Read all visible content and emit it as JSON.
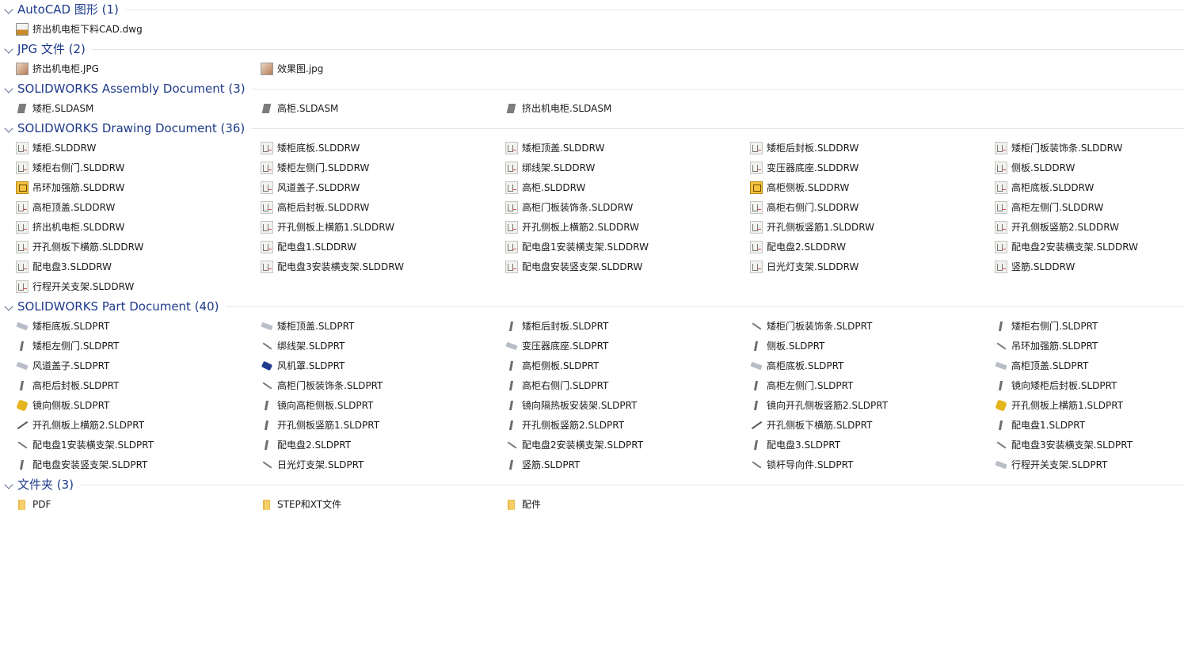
{
  "groups": [
    {
      "title": "AutoCAD 图形 (1)",
      "items": [
        {
          "label": "挤出机电柜下料CAD.dwg",
          "icon": "dwg-file-icon"
        }
      ]
    },
    {
      "title": "JPG 文件 (2)",
      "items": [
        {
          "label": "挤出机电柜.JPG",
          "icon": "jpg-file-icon"
        },
        {
          "label": "效果图.jpg",
          "icon": "jpg-file-icon"
        }
      ]
    },
    {
      "title": "SOLIDWORKS Assembly Document (3)",
      "items": [
        {
          "label": "矮柜.SLDASM",
          "icon": "assembly-icon"
        },
        {
          "label": "高柜.SLDASM",
          "icon": "assembly-icon"
        },
        {
          "label": "挤出机电柜.SLDASM",
          "icon": "assembly-icon"
        }
      ]
    },
    {
      "title": "SOLIDWORKS Drawing Document (36)",
      "items": [
        {
          "label": "矮柜.SLDDRW",
          "icon": "drawing-icon"
        },
        {
          "label": "矮柜底板.SLDDRW",
          "icon": "drawing-icon"
        },
        {
          "label": "矮柜顶盖.SLDDRW",
          "icon": "drawing-icon"
        },
        {
          "label": "矮柜后封板.SLDDRW",
          "icon": "drawing-icon"
        },
        {
          "label": "矮柜门板装饰条.SLDDRW",
          "icon": "drawing-icon"
        },
        {
          "label": "矮柜右侧门.SLDDRW",
          "icon": "drawing-icon"
        },
        {
          "label": "矮柜左侧门.SLDDRW",
          "icon": "drawing-icon"
        },
        {
          "label": "绑线架.SLDDRW",
          "icon": "drawing-icon"
        },
        {
          "label": "变压器底座.SLDDRW",
          "icon": "drawing-icon"
        },
        {
          "label": "侧板.SLDDRW",
          "icon": "drawing-icon"
        },
        {
          "label": "吊环加强筋.SLDDRW",
          "icon": "drawing-yellow-icon"
        },
        {
          "label": "风道盖子.SLDDRW",
          "icon": "drawing-icon"
        },
        {
          "label": "高柜.SLDDRW",
          "icon": "drawing-icon"
        },
        {
          "label": "高柜侧板.SLDDRW",
          "icon": "drawing-yellow-icon"
        },
        {
          "label": "高柜底板.SLDDRW",
          "icon": "drawing-icon"
        },
        {
          "label": "高柜顶盖.SLDDRW",
          "icon": "drawing-icon"
        },
        {
          "label": "高柜后封板.SLDDRW",
          "icon": "drawing-icon"
        },
        {
          "label": "高柜门板装饰条.SLDDRW",
          "icon": "drawing-icon"
        },
        {
          "label": "高柜右侧门.SLDDRW",
          "icon": "drawing-icon"
        },
        {
          "label": "高柜左侧门.SLDDRW",
          "icon": "drawing-icon"
        },
        {
          "label": "挤出机电柜.SLDDRW",
          "icon": "drawing-icon"
        },
        {
          "label": "开孔侧板上横筋1.SLDDRW",
          "icon": "drawing-icon"
        },
        {
          "label": "开孔侧板上横筋2.SLDDRW",
          "icon": "drawing-icon"
        },
        {
          "label": "开孔侧板竖筋1.SLDDRW",
          "icon": "drawing-icon"
        },
        {
          "label": "开孔侧板竖筋2.SLDDRW",
          "icon": "drawing-icon"
        },
        {
          "label": "开孔侧板下横筋.SLDDRW",
          "icon": "drawing-icon"
        },
        {
          "label": "配电盘1.SLDDRW",
          "icon": "drawing-icon"
        },
        {
          "label": "配电盘1安装横支架.SLDDRW",
          "icon": "drawing-icon"
        },
        {
          "label": "配电盘2.SLDDRW",
          "icon": "drawing-icon"
        },
        {
          "label": "配电盘2安装横支架.SLDDRW",
          "icon": "drawing-icon"
        },
        {
          "label": "配电盘3.SLDDRW",
          "icon": "drawing-icon"
        },
        {
          "label": "配电盘3安装横支架.SLDDRW",
          "icon": "drawing-icon"
        },
        {
          "label": "配电盘安装竖支架.SLDDRW",
          "icon": "drawing-icon"
        },
        {
          "label": "日光灯支架.SLDDRW",
          "icon": "drawing-icon"
        },
        {
          "label": "竖筋.SLDDRW",
          "icon": "drawing-icon"
        },
        {
          "label": "行程开关支架.SLDDRW",
          "icon": "drawing-icon"
        }
      ]
    },
    {
      "title": "SOLIDWORKS Part Document (40)",
      "items": [
        {
          "label": "矮柜底板.SLDPRT",
          "icon": "part-flat-icon"
        },
        {
          "label": "矮柜顶盖.SLDPRT",
          "icon": "part-flat-icon"
        },
        {
          "label": "矮柜后封板.SLDPRT",
          "icon": "part-vertical-icon"
        },
        {
          "label": "矮柜门板装饰条.SLDPRT",
          "icon": "part-diagonal-icon"
        },
        {
          "label": "矮柜右侧门.SLDPRT",
          "icon": "part-vertical-icon"
        },
        {
          "label": "矮柜左侧门.SLDPRT",
          "icon": "part-vertical-icon"
        },
        {
          "label": "绑线架.SLDPRT",
          "icon": "part-icon"
        },
        {
          "label": "变压器底座.SLDPRT",
          "icon": "part-flat-icon"
        },
        {
          "label": "侧板.SLDPRT",
          "icon": "part-vertical-icon"
        },
        {
          "label": "吊环加强筋.SLDPRT",
          "icon": "part-icon"
        },
        {
          "label": "风道盖子.SLDPRT",
          "icon": "part-flat-icon"
        },
        {
          "label": "风机罩.SLDPRT",
          "icon": "part-blue-icon"
        },
        {
          "label": "高柜侧板.SLDPRT",
          "icon": "part-vertical-icon"
        },
        {
          "label": "高柜底板.SLDPRT",
          "icon": "part-flat-icon"
        },
        {
          "label": "高柜顶盖.SLDPRT",
          "icon": "part-flat-icon"
        },
        {
          "label": "高柜后封板.SLDPRT",
          "icon": "part-vertical-icon"
        },
        {
          "label": "高柜门板装饰条.SLDPRT",
          "icon": "part-diagonal-icon"
        },
        {
          "label": "高柜右侧门.SLDPRT",
          "icon": "part-vertical-icon"
        },
        {
          "label": "高柜左侧门.SLDPRT",
          "icon": "part-vertical-icon"
        },
        {
          "label": "镜向矮柜后封板.SLDPRT",
          "icon": "part-vertical-icon"
        },
        {
          "label": "镜向侧板.SLDPRT",
          "icon": "part-yellow-icon"
        },
        {
          "label": "镜向高柜侧板.SLDPRT",
          "icon": "part-vertical-icon"
        },
        {
          "label": "镜向隔热板安装架.SLDPRT",
          "icon": "part-vertical-icon"
        },
        {
          "label": "镜向开孔侧板竖筋2.SLDPRT",
          "icon": "part-vertical-icon"
        },
        {
          "label": "开孔侧板上横筋1.SLDPRT",
          "icon": "part-yellow-icon"
        },
        {
          "label": "开孔侧板上横筋2.SLDPRT",
          "icon": "part-diagonal-up-icon"
        },
        {
          "label": "开孔侧板竖筋1.SLDPRT",
          "icon": "part-vertical-icon"
        },
        {
          "label": "开孔侧板竖筋2.SLDPRT",
          "icon": "part-vertical-icon"
        },
        {
          "label": "开孔侧板下横筋.SLDPRT",
          "icon": "part-diagonal-up-icon"
        },
        {
          "label": "配电盘1.SLDPRT",
          "icon": "part-vertical-icon"
        },
        {
          "label": "配电盘1安装横支架.SLDPRT",
          "icon": "part-diagonal-icon"
        },
        {
          "label": "配电盘2.SLDPRT",
          "icon": "part-vertical-icon"
        },
        {
          "label": "配电盘2安装横支架.SLDPRT",
          "icon": "part-diagonal-icon"
        },
        {
          "label": "配电盘3.SLDPRT",
          "icon": "part-vertical-icon"
        },
        {
          "label": "配电盘3安装横支架.SLDPRT",
          "icon": "part-diagonal-icon"
        },
        {
          "label": "配电盘安装竖支架.SLDPRT",
          "icon": "part-vertical-icon"
        },
        {
          "label": "日光灯支架.SLDPRT",
          "icon": "part-diagonal-icon"
        },
        {
          "label": "竖筋.SLDPRT",
          "icon": "part-vertical-icon"
        },
        {
          "label": "锁杆导向件.SLDPRT",
          "icon": "part-icon"
        },
        {
          "label": "行程开关支架.SLDPRT",
          "icon": "part-flat-icon"
        }
      ]
    },
    {
      "title": "文件夹 (3)",
      "items": [
        {
          "label": "PDF",
          "icon": "folder-icon"
        },
        {
          "label": "STEP和XT文件",
          "icon": "folder-icon"
        },
        {
          "label": "配件",
          "icon": "folder-icon"
        }
      ]
    }
  ]
}
